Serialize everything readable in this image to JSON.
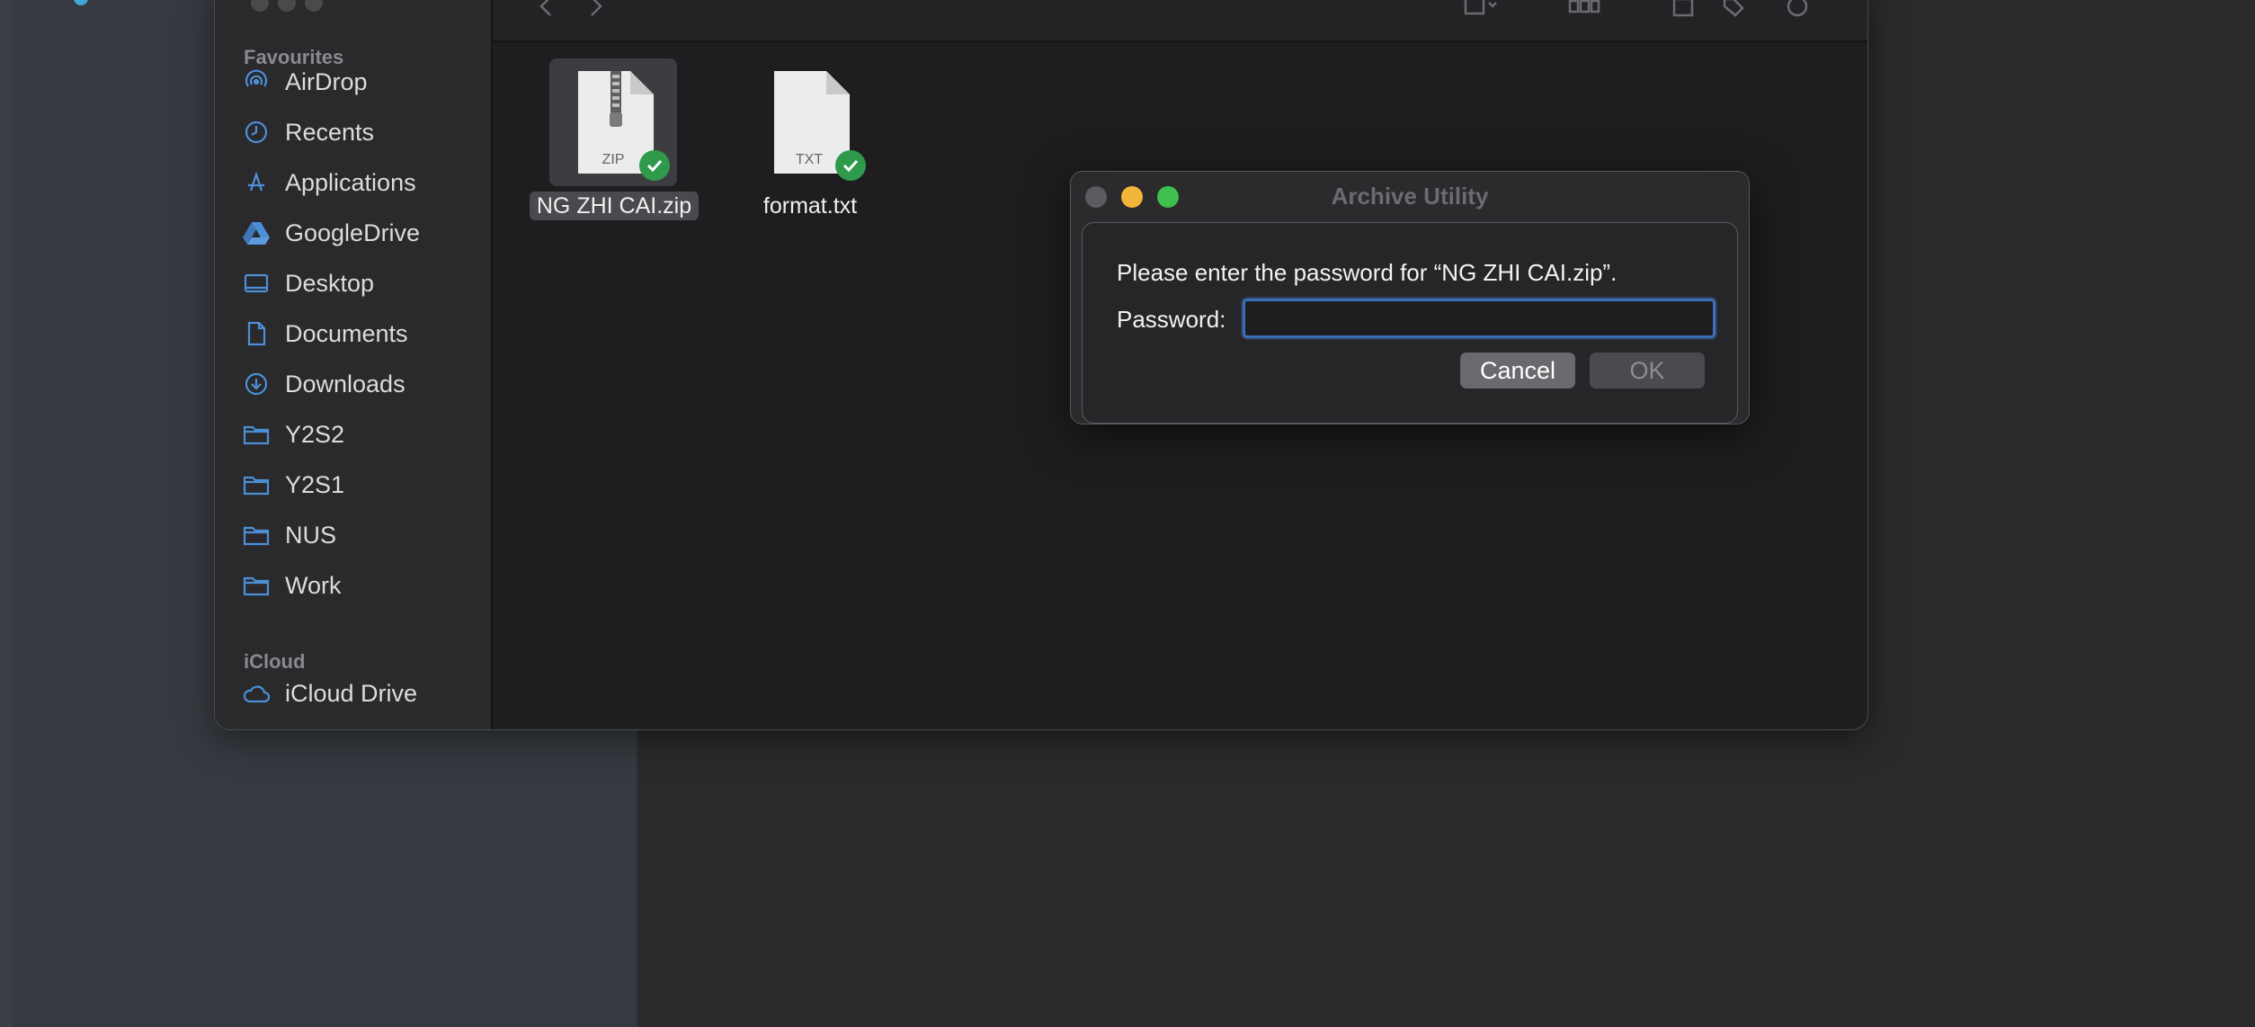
{
  "finder": {
    "sidebar": {
      "favourites_title": "Favourites",
      "items": [
        {
          "label": "AirDrop",
          "icon": "airdrop-icon"
        },
        {
          "label": "Recents",
          "icon": "clock-icon"
        },
        {
          "label": "Applications",
          "icon": "applications-icon"
        },
        {
          "label": "GoogleDrive",
          "icon": "google-drive-icon"
        },
        {
          "label": "Desktop",
          "icon": "desktop-icon"
        },
        {
          "label": "Documents",
          "icon": "document-icon"
        },
        {
          "label": "Downloads",
          "icon": "download-icon"
        },
        {
          "label": "Y2S2",
          "icon": "folder-icon"
        },
        {
          "label": "Y2S1",
          "icon": "folder-icon"
        },
        {
          "label": "NUS",
          "icon": "folder-icon"
        },
        {
          "label": "Work",
          "icon": "folder-icon"
        }
      ],
      "icloud_title": "iCloud",
      "icloud_items": [
        {
          "label": "iCloud Drive",
          "icon": "cloud-icon"
        }
      ]
    },
    "files": [
      {
        "name": "NG ZHI CAI.zip",
        "type_label": "ZIP",
        "selected": true,
        "synced": true
      },
      {
        "name": "format.txt",
        "type_label": "TXT",
        "selected": false,
        "synced": true
      }
    ]
  },
  "dialog": {
    "title": "Archive Utility",
    "message": "Please enter the password for “NG ZHI CAI.zip”.",
    "password_label": "Password:",
    "password_value": "",
    "cancel_label": "Cancel",
    "ok_label": "OK"
  },
  "colors": {
    "accent": "#3c70b8",
    "sync_badge": "#2f9a4b",
    "close": "#5b5a5e",
    "minimize": "#f2b53a",
    "zoom": "#3fbf4c"
  }
}
